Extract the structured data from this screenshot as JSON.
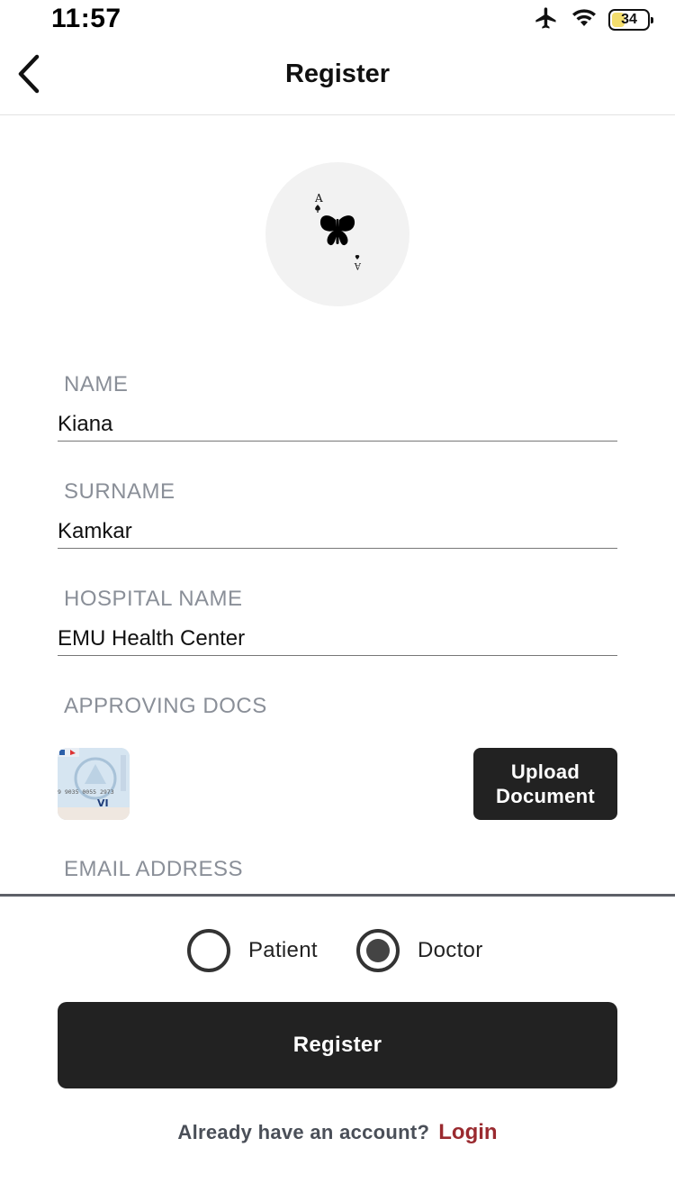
{
  "status_bar": {
    "time": "11:57",
    "battery": "34",
    "icons": [
      "airplane-icon",
      "wifi-icon",
      "battery-icon"
    ]
  },
  "nav": {
    "title": "Register",
    "back_icon": "chevron-left-icon"
  },
  "avatar": {
    "icon": "butterfly-ace-card-icon"
  },
  "form": {
    "name": {
      "label": "NAME",
      "value": "Kiana"
    },
    "surname": {
      "label": "SURNAME",
      "value": "Kamkar"
    },
    "hospital": {
      "label": "HOSPITAL NAME",
      "value": "EMU Health Center"
    },
    "docs": {
      "label": "APPROVING DOCS",
      "thumb_text": "9 9035 0055 2973",
      "thumb_brand": "VI",
      "upload_label": "Upload Document"
    },
    "email": {
      "label": "EMAIL ADDRESS"
    }
  },
  "role": {
    "options": [
      {
        "label": "Patient",
        "selected": false
      },
      {
        "label": "Doctor",
        "selected": true
      }
    ]
  },
  "actions": {
    "register_label": "Register",
    "login_prompt": "Already have an account?",
    "login_link": "Login"
  },
  "colors": {
    "primary_button": "#222222",
    "label_gray": "#8a8f98",
    "link_red": "#9a2a2f",
    "battery_fill": "#f3dd6d"
  }
}
